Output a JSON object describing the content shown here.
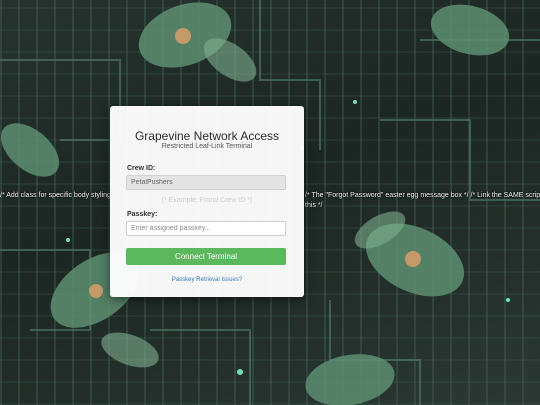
{
  "background": {
    "description_icon": "circuit-foliage-pattern",
    "colors": {
      "leaf": "#5e8f72",
      "circuit": "#3e5c52",
      "dark": "#1c2622"
    }
  },
  "leaked_text": {
    "line1": "/* Add class for specific body styling",
    "line2": "/* The \"Forgot Password\" easter egg message box */ /* Link the SAME script",
    "line3": "this */"
  },
  "login": {
    "title": "Grapevine Network Access",
    "subtitle": "Restricted Leaf-Link Terminal",
    "crew_label": "Crew ID:",
    "crew_value": "PetalPushers",
    "crew_hint": "(* Example: Frond Crew ID *)",
    "passkey_label": "Passkey:",
    "passkey_placeholder": "Enter assigned passkey...",
    "submit_label": "Connect Terminal",
    "help_link": "Passkey Retrieval Issues?",
    "accent_color": "#5cb85c",
    "link_color": "#337ab7"
  }
}
